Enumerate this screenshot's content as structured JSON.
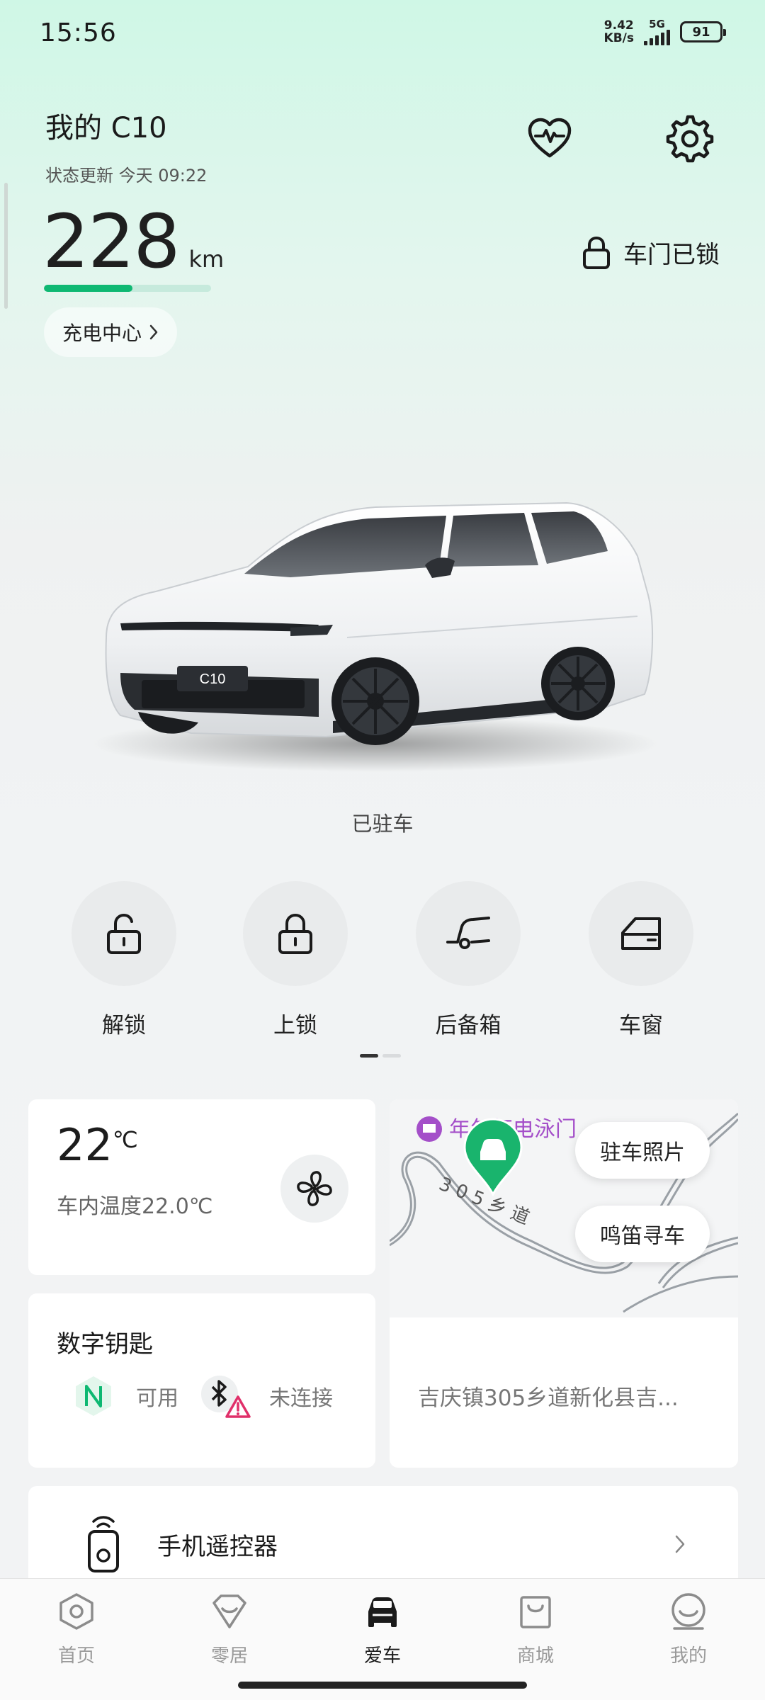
{
  "status_bar": {
    "time": "15:56",
    "net_speed_value": "9.42",
    "net_speed_unit": "KB/s",
    "network": "5G",
    "battery": "91"
  },
  "header": {
    "title": "我的 C10",
    "status_update": "状态更新 今天 09:22",
    "range_value": "228",
    "range_unit": "km",
    "range_level_fraction": 0.53,
    "charge_center_label": "充电中心",
    "door_lock_status": "车门已锁"
  },
  "car": {
    "plate_label": "C10",
    "state": "已驻车"
  },
  "quick_actions": [
    {
      "label": "解锁",
      "icon": "unlock-icon"
    },
    {
      "label": "上锁",
      "icon": "lock-icon"
    },
    {
      "label": "后备箱",
      "icon": "trunk-icon"
    },
    {
      "label": "车窗",
      "icon": "window-icon"
    }
  ],
  "climate": {
    "temp_value": "22",
    "temp_unit": "℃",
    "cabin_temp_text": "车内温度22.0℃"
  },
  "digital_key": {
    "title": "数字钥匙",
    "nfc_status": "可用",
    "bluetooth_status": "未连接"
  },
  "map": {
    "poi_name": "年年红电泳门",
    "road_label": "3 0 5 乡 道",
    "parking_photo_label": "驻车照片",
    "honk_find_label": "鸣笛寻车",
    "address": "吉庆镇305乡道新化县吉..."
  },
  "remote": {
    "label": "手机遥控器"
  },
  "bottom_nav": [
    {
      "label": "首页",
      "icon": "home-hexagon-icon",
      "active": false
    },
    {
      "label": "零居",
      "icon": "heart-badge-icon",
      "active": false
    },
    {
      "label": "爱车",
      "icon": "car-icon",
      "active": true
    },
    {
      "label": "商城",
      "icon": "shopping-bag-icon",
      "active": false
    },
    {
      "label": "我的",
      "icon": "profile-icon",
      "active": false
    }
  ],
  "colors": {
    "accent_green": "#0eb872",
    "warning_pink": "#e0306a",
    "poi_purple": "#a44fc9"
  }
}
